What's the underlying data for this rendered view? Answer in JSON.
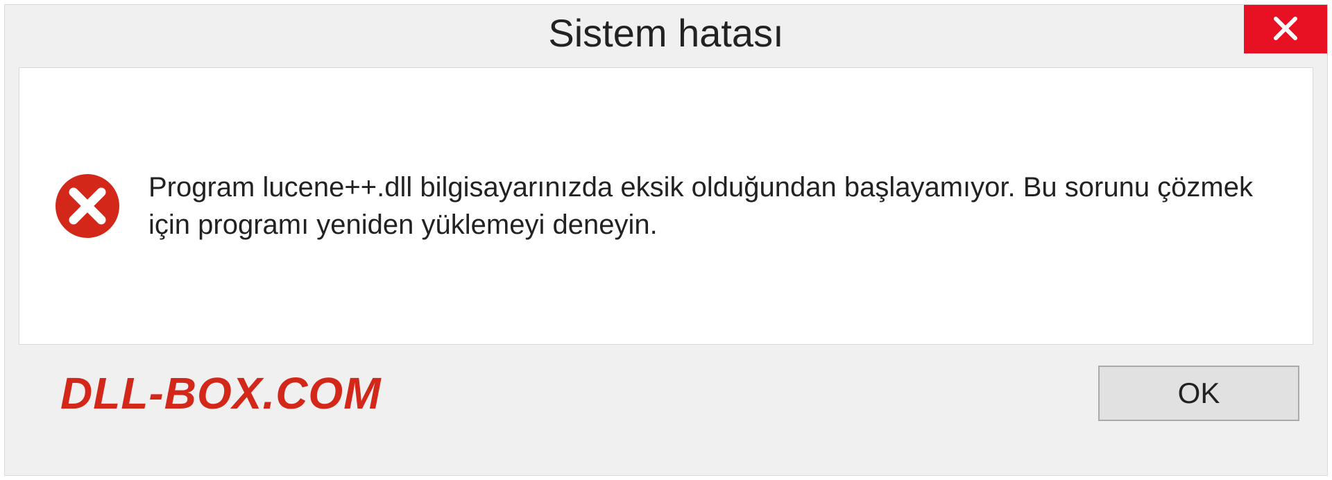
{
  "dialog": {
    "title": "Sistem hatası",
    "message": "Program lucene++.dll bilgisayarınızda eksik olduğundan başlayamıyor. Bu sorunu çözmek için programı yeniden yüklemeyi deneyin.",
    "ok_label": "OK"
  },
  "watermark": "DLL-BOX.COM",
  "colors": {
    "close_bg": "#e81123",
    "watermark": "#d22719"
  }
}
